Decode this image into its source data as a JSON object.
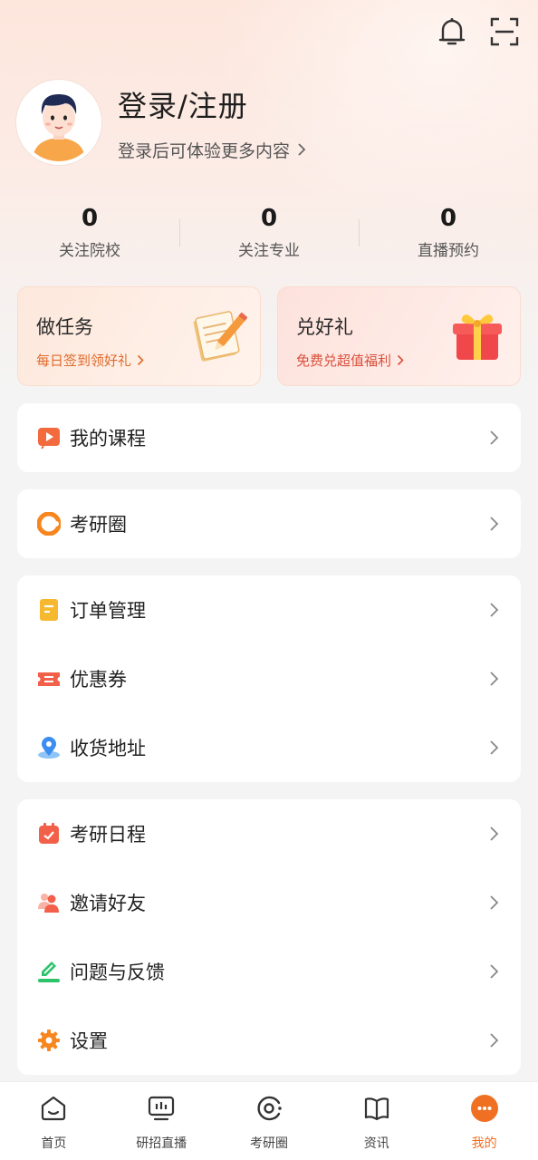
{
  "header": {
    "icons": [
      "bell-icon",
      "scan-icon"
    ]
  },
  "profile": {
    "title": "登录/注册",
    "subtitle": "登录后可体验更多内容"
  },
  "stats": [
    {
      "value": "0",
      "label": "关注院校"
    },
    {
      "value": "0",
      "label": "关注专业"
    },
    {
      "value": "0",
      "label": "直播预约"
    }
  ],
  "promos": [
    {
      "title": "做任务",
      "subtitle": "每日签到领好礼",
      "icon": "notebook-pencil-icon"
    },
    {
      "title": "兑好礼",
      "subtitle": "免费兑超值福利",
      "icon": "gift-box-icon"
    }
  ],
  "menu": {
    "courses": {
      "label": "我的课程",
      "icon": "play-icon",
      "color": "#f26a3d"
    },
    "circle": {
      "label": "考研圈",
      "icon": "ring-icon",
      "color": "#f7861e"
    },
    "orders": {
      "label": "订单管理",
      "icon": "order-icon",
      "color": "#f5b82e"
    },
    "coupons": {
      "label": "优惠券",
      "icon": "coupon-icon",
      "color": "#f2604a"
    },
    "address": {
      "label": "收货地址",
      "icon": "location-icon",
      "color": "#3b8df0"
    },
    "schedule": {
      "label": "考研日程",
      "icon": "calendar-icon",
      "color": "#f2604a"
    },
    "invite": {
      "label": "邀请好友",
      "icon": "people-icon",
      "color": "#f2604a"
    },
    "feedback": {
      "label": "问题与反馈",
      "icon": "edit-icon",
      "color": "#2cc36b"
    },
    "settings": {
      "label": "设置",
      "icon": "gear-icon",
      "color": "#f7861e"
    }
  },
  "tabs": [
    {
      "label": "首页",
      "icon": "home-icon"
    },
    {
      "label": "研招直播",
      "icon": "tv-icon"
    },
    {
      "label": "考研圈",
      "icon": "circle-icon"
    },
    {
      "label": "资讯",
      "icon": "book-icon"
    },
    {
      "label": "我的",
      "icon": "me-icon",
      "active": true
    }
  ],
  "colors": {
    "accent": "#f07023"
  }
}
